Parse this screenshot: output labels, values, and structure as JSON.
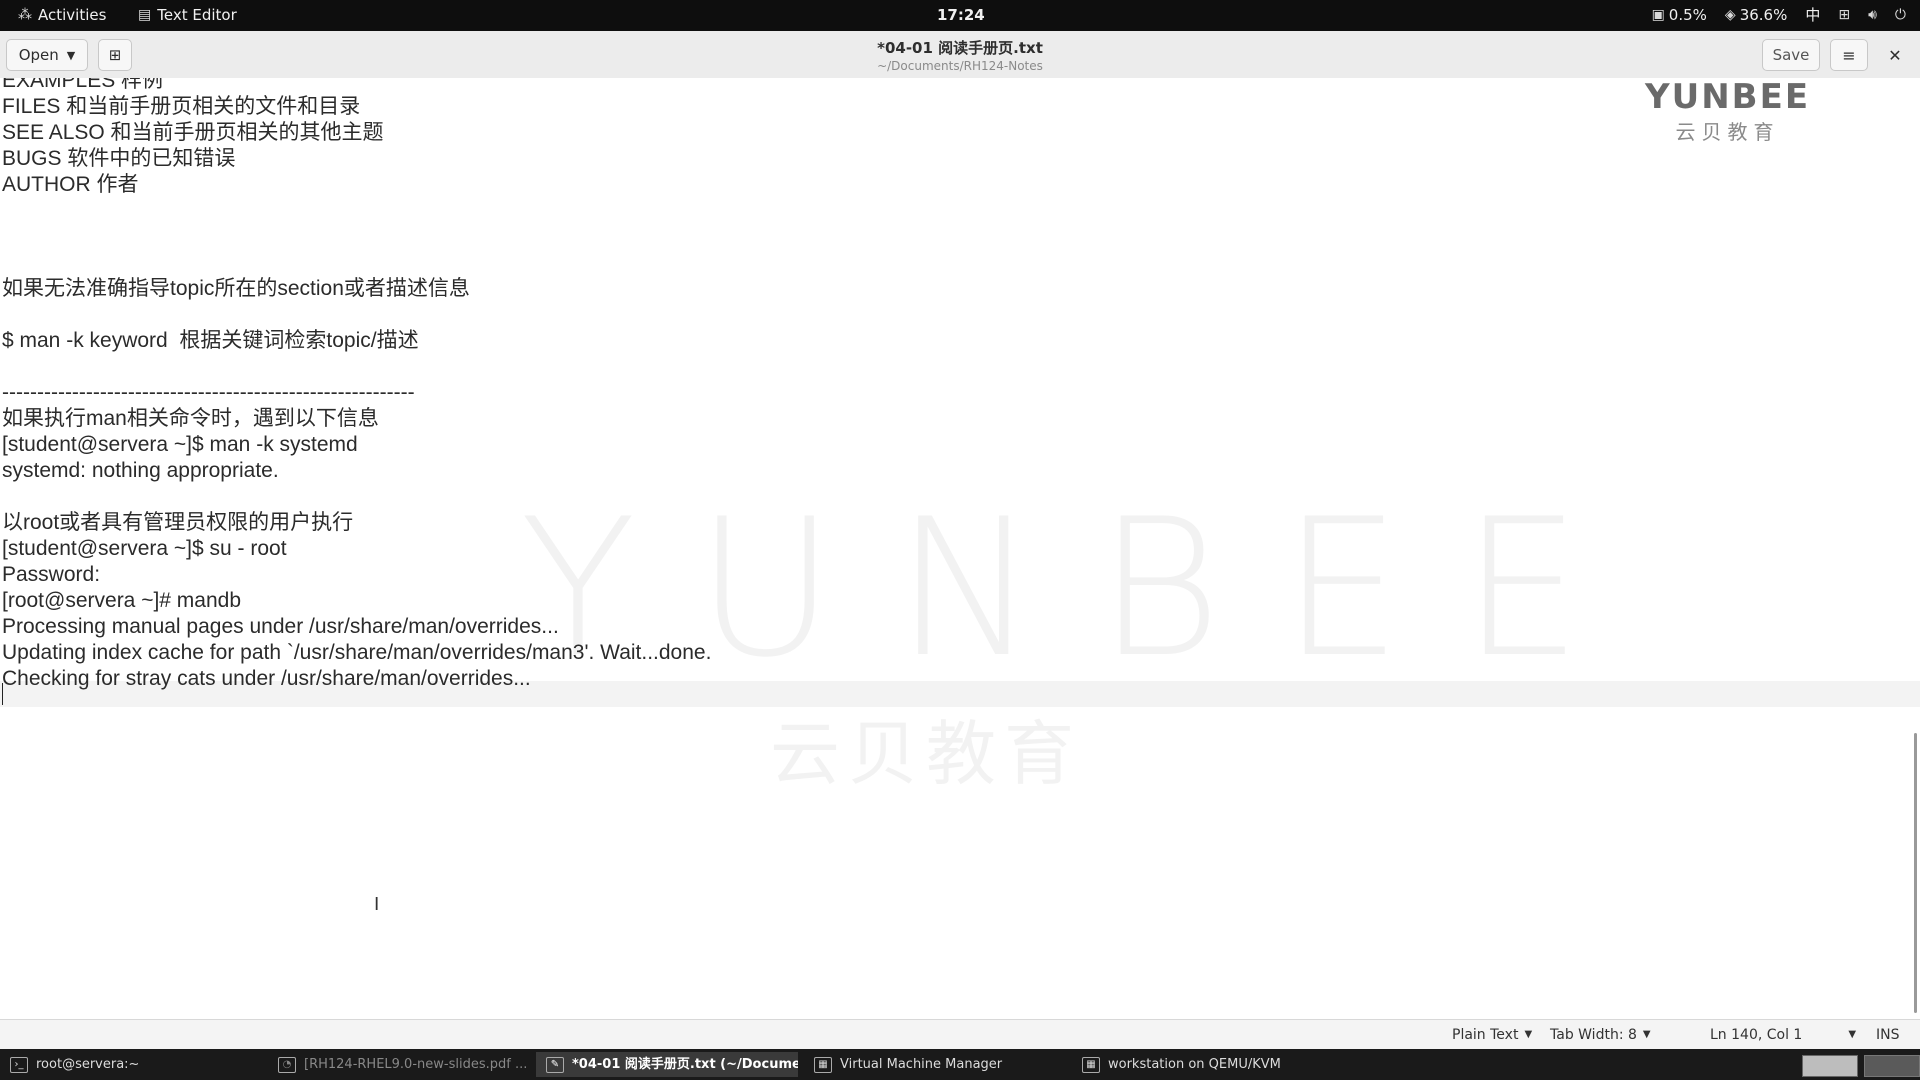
{
  "topbar": {
    "activities": "Activities",
    "app_name": "Text Editor",
    "clock": "17:24",
    "cpu_percent": "0.5%",
    "other_percent": "36.6%",
    "input_method": "中"
  },
  "headerbar": {
    "open_label": "Open",
    "title": "*04-01 阅读手册页.txt",
    "subtitle": "~/Documents/RH124-Notes",
    "save_label": "Save"
  },
  "editor": {
    "lines": [
      "EXAMPLES 样例",
      "FILES 和当前手册页相关的文件和目录",
      "SEE ALSO 和当前手册页相关的其他主题",
      "BUGS 软件中的已知错误",
      "AUTHOR 作者",
      "",
      "",
      "",
      "如果无法准确指导topic所在的section或者描述信息",
      "",
      "$ man -k keyword  根据关键词检索topic/描述",
      "",
      "-----------------------------------------------------------",
      "如果执行man相关命令时，遇到以下信息",
      "[student@servera ~]$ man -k systemd",
      "systemd: nothing appropriate.",
      "",
      "以root或者具有管理员权限的用户执行",
      "[student@servera ~]$ su - root",
      "Password:",
      "[root@servera ~]# mandb",
      "Processing manual pages under /usr/share/man/overrides...",
      "Updating index cache for path `/usr/share/man/overrides/man3'. Wait...done.",
      "Checking for stray cats under /usr/share/man/overrides...",
      ""
    ]
  },
  "watermark": {
    "big": "YUNBEE",
    "cn": "云贝教育",
    "logo_en": "YUNBEE",
    "logo_cn": "云贝教育"
  },
  "statusbar": {
    "language": "Plain Text",
    "tab_width": "Tab Width: 8",
    "position": "Ln 140, Col 1",
    "mode": "INS"
  },
  "taskbar": {
    "items": [
      {
        "label": "root@servera:~"
      },
      {
        "label": "[RH124-RHEL9.0-new-slides.pdf ..."
      },
      {
        "label": "*04-01 阅读手册页.txt (~/Docume..."
      },
      {
        "label": "Virtual Machine Manager"
      },
      {
        "label": "workstation on QEMU/KVM"
      }
    ]
  }
}
